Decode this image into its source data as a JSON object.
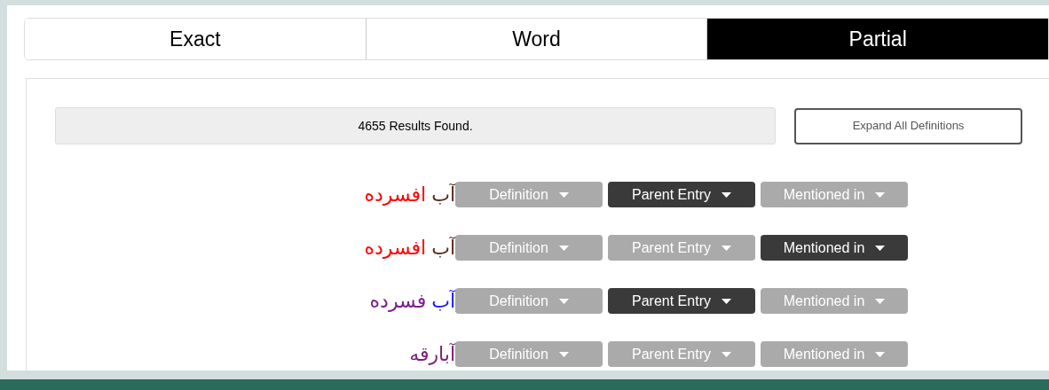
{
  "tabs": [
    {
      "label": "Exact",
      "selected": false
    },
    {
      "label": "Word",
      "selected": false
    },
    {
      "label": "Partial",
      "selected": true
    }
  ],
  "results": {
    "count_text": "4655 Results Found.",
    "expand_button": "Expand All Definitions"
  },
  "entries": [
    {
      "words": [
        {
          "text": "آب",
          "color": "#5b2a1e"
        },
        {
          "text": "افسرده",
          "color": "#ff0000"
        }
      ],
      "buttons": [
        {
          "label": "Definition",
          "selected": false
        },
        {
          "label": "Parent Entry",
          "selected": true
        },
        {
          "label": "Mentioned in",
          "selected": false
        }
      ]
    },
    {
      "words": [
        {
          "text": "آب",
          "color": "#5b2a1e"
        },
        {
          "text": "افسرده",
          "color": "#ff0000"
        }
      ],
      "buttons": [
        {
          "label": "Definition",
          "selected": false
        },
        {
          "label": "Parent Entry",
          "selected": false
        },
        {
          "label": "Mentioned in",
          "selected": true
        }
      ]
    },
    {
      "words": [
        {
          "text": "آب",
          "color": "#1a1aff"
        },
        {
          "text": "فسرده",
          "color": "#7a1e8c"
        }
      ],
      "buttons": [
        {
          "label": "Definition",
          "selected": false
        },
        {
          "label": "Parent Entry",
          "selected": true
        },
        {
          "label": "Mentioned in",
          "selected": false
        }
      ]
    },
    {
      "words": [
        {
          "text": "آبارقه",
          "color": "#7a1e7a"
        }
      ],
      "buttons": [
        {
          "label": "Definition",
          "selected": false
        },
        {
          "label": "Parent Entry",
          "selected": false
        },
        {
          "label": "Mentioned in",
          "selected": false
        }
      ]
    }
  ]
}
